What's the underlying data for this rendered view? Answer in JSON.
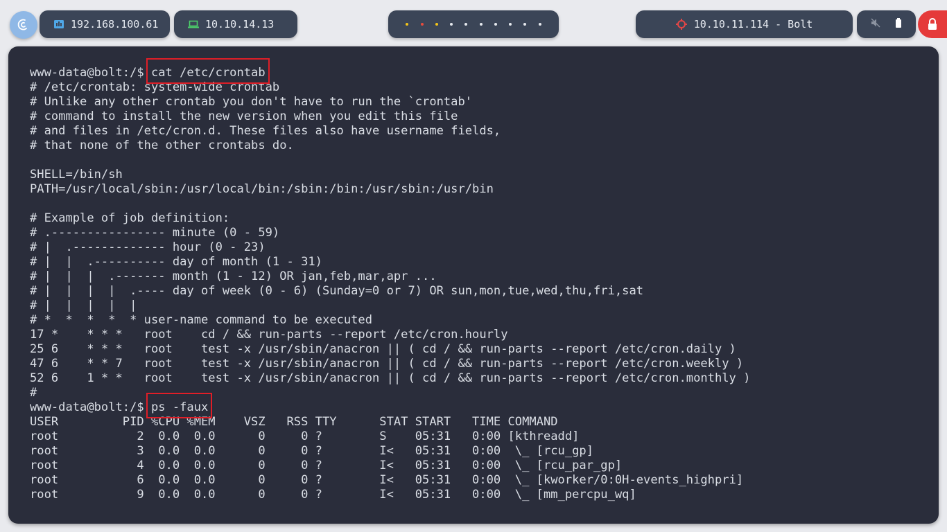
{
  "topbar": {
    "host_ip": "192.168.100.61",
    "vpn_ip": "10.10.14.13",
    "target": "10.10.11.114 - Bolt",
    "workspace_dots": [
      {
        "color": "#f5c518"
      },
      {
        "color": "#e84c3d"
      },
      {
        "color": "#f5c518"
      },
      {
        "color": "#e6e9ee"
      },
      {
        "color": "#e6e9ee"
      },
      {
        "color": "#e6e9ee"
      },
      {
        "color": "#e6e9ee"
      },
      {
        "color": "#e6e9ee"
      },
      {
        "color": "#e6e9ee"
      },
      {
        "color": "#e6e9ee"
      }
    ],
    "icons": {
      "logo": "debian-swirl-icon",
      "host": "ethernet-icon",
      "vpn": "laptop-icon",
      "target": "crosshair-icon",
      "sound": "mute-icon",
      "battery": "battery-icon",
      "power": "lock-icon"
    },
    "colors": {
      "host_icon": "#4fa8e8",
      "vpn_icon": "#4cd06a",
      "target_icon": "#e64646",
      "power_bg": "#e53a3a"
    }
  },
  "terminal": {
    "prompt": "www-data@bolt:/$",
    "commands": [
      "cat /etc/crontab",
      "ps -faux"
    ],
    "crontab_output": [
      "# /etc/crontab: system-wide crontab",
      "# Unlike any other crontab you don't have to run the `crontab'",
      "# command to install the new version when you edit this file",
      "# and files in /etc/cron.d. These files also have username fields,",
      "# that none of the other crontabs do.",
      "",
      "SHELL=/bin/sh",
      "PATH=/usr/local/sbin:/usr/local/bin:/sbin:/bin:/usr/sbin:/usr/bin",
      "",
      "# Example of job definition:",
      "# .---------------- minute (0 - 59)",
      "# |  .------------- hour (0 - 23)",
      "# |  |  .---------- day of month (1 - 31)",
      "# |  |  |  .------- month (1 - 12) OR jan,feb,mar,apr ...",
      "# |  |  |  |  .---- day of week (0 - 6) (Sunday=0 or 7) OR sun,mon,tue,wed,thu,fri,sat",
      "# |  |  |  |  |",
      "# *  *  *  *  * user-name command to be executed",
      "17 *    * * *   root    cd / && run-parts --report /etc/cron.hourly",
      "25 6    * * *   root    test -x /usr/sbin/anacron || ( cd / && run-parts --report /etc/cron.daily )",
      "47 6    * * 7   root    test -x /usr/sbin/anacron || ( cd / && run-parts --report /etc/cron.weekly )",
      "52 6    1 * *   root    test -x /usr/sbin/anacron || ( cd / && run-parts --report /etc/cron.monthly )",
      "#"
    ],
    "ps_output": [
      "USER         PID %CPU %MEM    VSZ   RSS TTY      STAT START   TIME COMMAND",
      "root           2  0.0  0.0      0     0 ?        S    05:31   0:00 [kthreadd]",
      "root           3  0.0  0.0      0     0 ?        I<   05:31   0:00  \\_ [rcu_gp]",
      "root           4  0.0  0.0      0     0 ?        I<   05:31   0:00  \\_ [rcu_par_gp]",
      "root           6  0.0  0.0      0     0 ?        I<   05:31   0:00  \\_ [kworker/0:0H-events_highpri]",
      "root           9  0.0  0.0      0     0 ?        I<   05:31   0:00  \\_ [mm_percpu_wq]"
    ]
  }
}
